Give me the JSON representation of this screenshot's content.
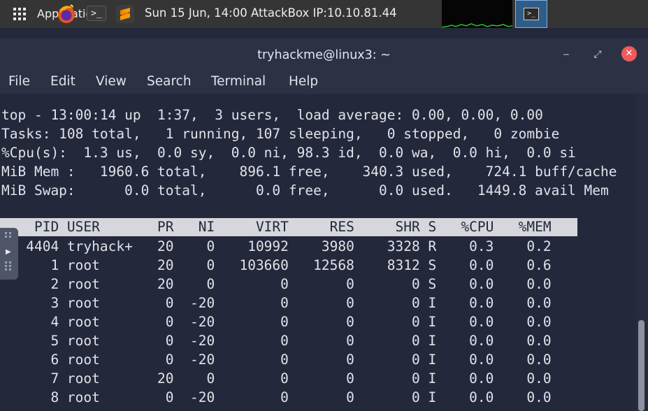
{
  "panel": {
    "apps_label": "Applications",
    "term_launcher_glyph": ">_",
    "clock": "Sun 15 Jun, 14:00 AttackBox IP:10.10.81.44",
    "task_button_glyph": ">_",
    "icons": [
      "grid-icon",
      "firefox-icon",
      "terminal-icon",
      "sublime-text-icon",
      "system-monitor-graph",
      "terminal-icon"
    ]
  },
  "window": {
    "title": "tryhackme@linux3: ~",
    "minimize_glyph": "‒",
    "maximize_glyph": "⤢",
    "close_glyph": "✕",
    "menu": [
      "File",
      "Edit",
      "View",
      "Search",
      "Terminal",
      "Help"
    ]
  },
  "top": {
    "summary": [
      "top - 13:00:14 up  1:37,  3 users,  load average: 0.00, 0.00, 0.00",
      "Tasks: 108 total,   1 running, 107 sleeping,   0 stopped,   0 zombie",
      "%Cpu(s):  1.3 us,  0.0 sy,  0.0 ni, 98.3 id,  0.0 wa,  0.0 hi,  0.0 si",
      "MiB Mem :   1960.6 total,    896.1 free,    340.3 used,    724.1 buff/cache",
      "MiB Swap:      0.0 total,      0.0 free,      0.0 used.   1449.8 avail Mem"
    ],
    "columns": [
      "PID",
      "USER",
      "PR",
      "NI",
      "VIRT",
      "RES",
      "SHR",
      "S",
      "%CPU",
      "%MEM"
    ],
    "rows": [
      {
        "pid": "4404",
        "user": "tryhack+",
        "pr": "20",
        "ni": "0",
        "virt": "10992",
        "res": "3980",
        "shr": "3328",
        "s": "R",
        "cpu": "0.3",
        "mem": "0.2"
      },
      {
        "pid": "1",
        "user": "root",
        "pr": "20",
        "ni": "0",
        "virt": "103660",
        "res": "12568",
        "shr": "8312",
        "s": "S",
        "cpu": "0.0",
        "mem": "0.6"
      },
      {
        "pid": "2",
        "user": "root",
        "pr": "20",
        "ni": "0",
        "virt": "0",
        "res": "0",
        "shr": "0",
        "s": "S",
        "cpu": "0.0",
        "mem": "0.0"
      },
      {
        "pid": "3",
        "user": "root",
        "pr": "0",
        "ni": "-20",
        "virt": "0",
        "res": "0",
        "shr": "0",
        "s": "I",
        "cpu": "0.0",
        "mem": "0.0"
      },
      {
        "pid": "4",
        "user": "root",
        "pr": "0",
        "ni": "-20",
        "virt": "0",
        "res": "0",
        "shr": "0",
        "s": "I",
        "cpu": "0.0",
        "mem": "0.0"
      },
      {
        "pid": "5",
        "user": "root",
        "pr": "0",
        "ni": "-20",
        "virt": "0",
        "res": "0",
        "shr": "0",
        "s": "I",
        "cpu": "0.0",
        "mem": "0.0"
      },
      {
        "pid": "6",
        "user": "root",
        "pr": "0",
        "ni": "-20",
        "virt": "0",
        "res": "0",
        "shr": "0",
        "s": "I",
        "cpu": "0.0",
        "mem": "0.0"
      },
      {
        "pid": "7",
        "user": "root",
        "pr": "20",
        "ni": "0",
        "virt": "0",
        "res": "0",
        "shr": "0",
        "s": "I",
        "cpu": "0.0",
        "mem": "0.0"
      },
      {
        "pid": "8",
        "user": "root",
        "pr": "0",
        "ni": "-20",
        "virt": "0",
        "res": "0",
        "shr": "0",
        "s": "I",
        "cpu": "0.0",
        "mem": "0.0"
      }
    ]
  },
  "colors": {
    "panel_bg": "#353535",
    "window_chrome": "#2c3244",
    "terminal_bg": "#24283b",
    "terminal_fg": "#e1e3e8",
    "header_bar": "#d6d7dc",
    "close_button": "#ef5a5a",
    "active_task": "#2f5d87"
  }
}
